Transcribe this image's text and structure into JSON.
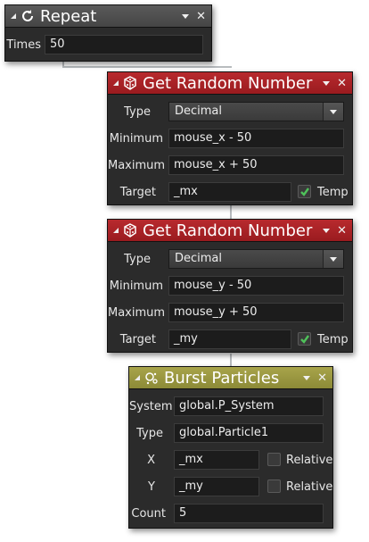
{
  "repeat": {
    "title": "Repeat",
    "times_label": "Times",
    "times_value": "50"
  },
  "random_x": {
    "title": "Get Random Number",
    "type_label": "Type",
    "type_value": "Decimal",
    "minimum_label": "Minimum",
    "minimum_value": "mouse_x - 50",
    "maximum_label": "Maximum",
    "maximum_value": "mouse_x + 50",
    "target_label": "Target",
    "target_value": "_mx",
    "temp_label": "Temp",
    "temp_checked": true
  },
  "random_y": {
    "title": "Get Random Number",
    "type_label": "Type",
    "type_value": "Decimal",
    "minimum_label": "Minimum",
    "minimum_value": "mouse_y - 50",
    "maximum_label": "Maximum",
    "maximum_value": "mouse_y + 50",
    "target_label": "Target",
    "target_value": "_my",
    "temp_label": "Temp",
    "temp_checked": true
  },
  "burst": {
    "title": "Burst Particles",
    "system_label": "System",
    "system_value": "global.P_System",
    "type_label": "Type",
    "type_value": "global.Particle1",
    "x_label": "X",
    "x_value": "_mx",
    "x_relative_label": "Relative",
    "x_relative_checked": false,
    "y_label": "Y",
    "y_value": "_my",
    "y_relative_label": "Relative",
    "y_relative_checked": false,
    "count_label": "Count",
    "count_value": "5"
  },
  "colors": {
    "repeat_header": "#4f4f4f",
    "random_header": "#a82226",
    "burst_header": "#9a9840",
    "panel_bg": "#2b2b2b",
    "check_green": "#4fc25a"
  }
}
